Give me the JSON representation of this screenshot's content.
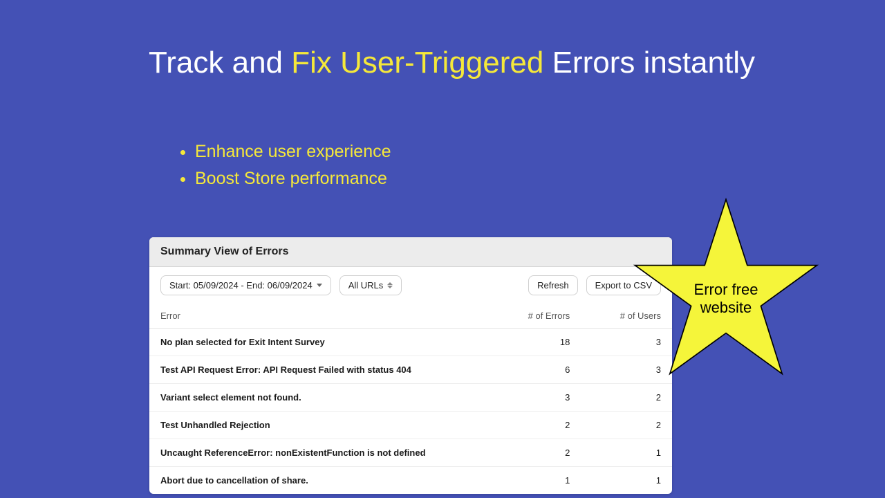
{
  "heading": {
    "before": "Track and ",
    "highlight": "Fix User-Triggered",
    "after": " Errors instantly"
  },
  "bullets": [
    "Enhance user experience",
    "Boost Store performance"
  ],
  "panel": {
    "title": "Summary View of Errors",
    "date_range_label": "Start: 05/09/2024 - End: 06/09/2024",
    "url_filter_label": "All URLs",
    "refresh_label": "Refresh",
    "export_label": "Export to CSV",
    "columns": {
      "error": "Error",
      "errors": "# of Errors",
      "users": "# of Users"
    },
    "rows": [
      {
        "error": "No plan selected for Exit Intent Survey",
        "errors": 18,
        "users": 3
      },
      {
        "error": "Test API Request Error: API Request Failed with status 404",
        "errors": 6,
        "users": 3
      },
      {
        "error": "Variant select element not found.",
        "errors": 3,
        "users": 2
      },
      {
        "error": "Test Unhandled Rejection",
        "errors": 2,
        "users": 2
      },
      {
        "error": "Uncaught ReferenceError: nonExistentFunction is not defined",
        "errors": 2,
        "users": 1
      },
      {
        "error": "Abort due to cancellation of share.",
        "errors": 1,
        "users": 1
      }
    ]
  },
  "star": {
    "line1": "Error free",
    "line2": "website"
  },
  "colors": {
    "bg": "#4451b5",
    "accent": "#f5e83a"
  }
}
